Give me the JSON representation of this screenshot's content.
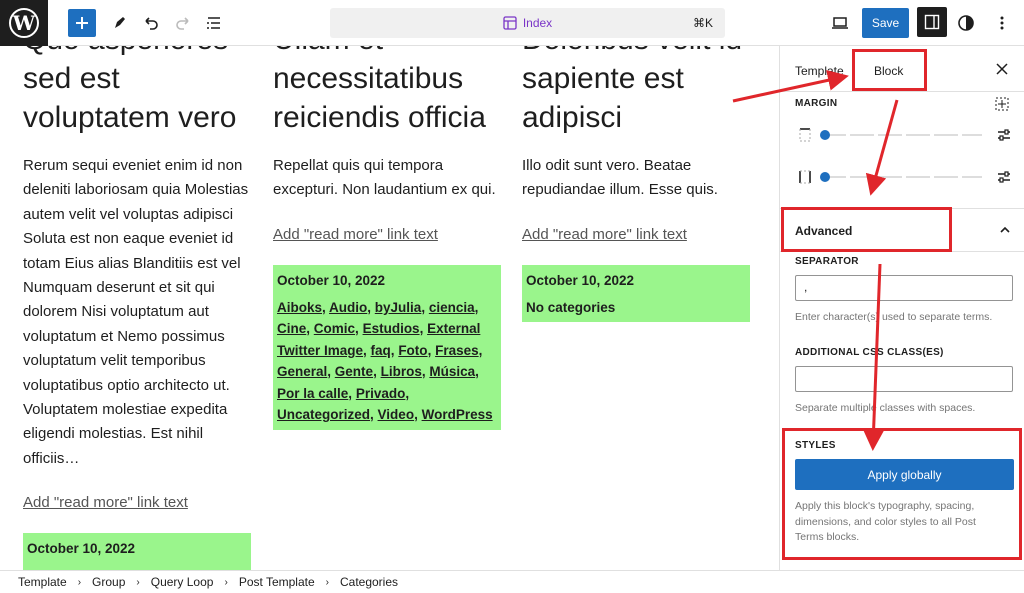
{
  "topbar": {
    "command_title": "Index",
    "command_shortcut": "⌘K",
    "save_label": "Save"
  },
  "posts": [
    {
      "title": "Quo asperiores sed est voluptatem vero",
      "excerpt": "Rerum sequi eveniet enim id non deleniti laboriosam quia Molestias autem velit vel voluptas adipisci Soluta est non eaque eveniet id totam Eius alias Blanditiis est vel Numquam deserunt et sit qui dolorem Nisi voluptatum aut voluptatum et Nemo possimus voluptatum velit temporibus voluptatibus optio architecto ut. Voluptatem molestiae expedita eligendi molestias. Est nihil officiis…",
      "read_more": "Add \"read more\" link text",
      "date": "October 10, 2022"
    },
    {
      "title": "Ullam et necessitatibus reiciendis officia",
      "excerpt": "Repellat quis qui tempora excepturi. Non laudantium ex qui.",
      "read_more": "Add \"read more\" link text",
      "date": "October 10, 2022",
      "categories": [
        "Aiboks",
        "Audio",
        "byJulia",
        "ciencia",
        "Cine",
        "Comic",
        "Estudios",
        "External Twitter Image",
        "faq",
        "Foto",
        "Frases",
        "General",
        "Gente",
        "Libros",
        "Música",
        "Por la calle",
        "Privado",
        "Uncategorized",
        "Video",
        "WordPress"
      ]
    },
    {
      "title": "Doloribus velit id sapiente est adipisci",
      "excerpt": "Illo odit sunt vero. Beatae repudiandae illum. Esse quis.",
      "read_more": "Add \"read more\" link text",
      "date": "October 10, 2022",
      "no_categories": "No categories"
    }
  ],
  "sidebar": {
    "tab_template": "Template",
    "tab_block": "Block",
    "margin_label": "MARGIN",
    "advanced_label": "Advanced",
    "separator_label": "SEPARATOR",
    "separator_value": ",",
    "separator_help": "Enter character(s) used to separate terms.",
    "css_class_label": "ADDITIONAL CSS CLASS(ES)",
    "css_class_help": "Separate multiple classes with spaces.",
    "styles_label": "STYLES",
    "apply_globally": "Apply globally",
    "apply_help": "Apply this block's typography, spacing, dimensions, and color styles to all Post Terms blocks."
  },
  "breadcrumbs": [
    "Template",
    "Group",
    "Query Loop",
    "Post Template",
    "Categories"
  ],
  "colors": {
    "accent": "#1e6fbf",
    "highlight": "#9af58c",
    "annotation": "#e0262b",
    "purple": "#7a35c7"
  }
}
